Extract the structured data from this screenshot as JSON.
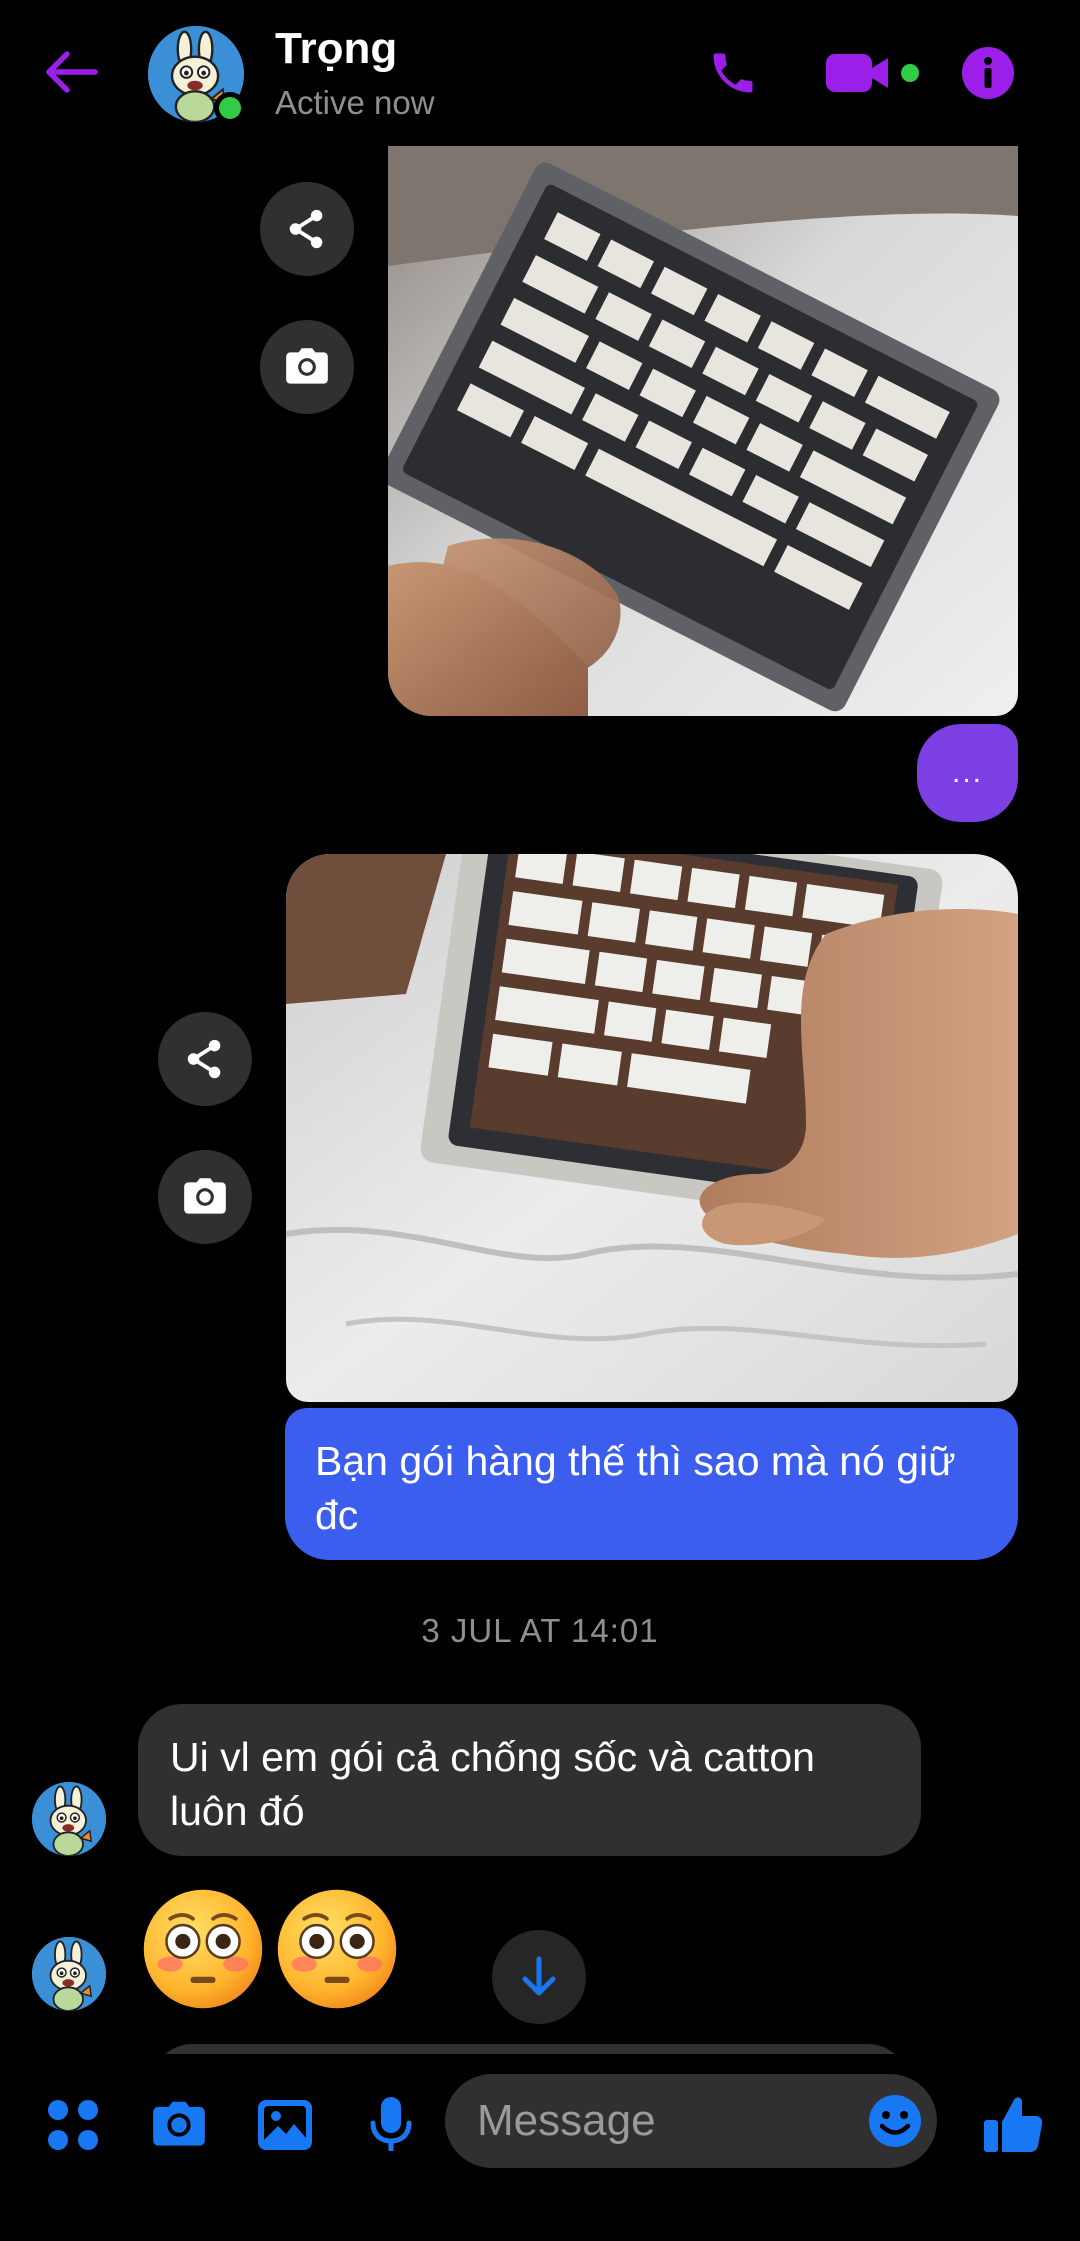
{
  "colors": {
    "accent": "#9b1fe8",
    "sent_bubble": "#3b5eee",
    "typing_bubble": "#7b3fe4",
    "received_bubble": "#303030",
    "online": "#31cc46",
    "composer_icon": "#1877f2"
  },
  "header": {
    "name": "Trọng",
    "status": "Active now",
    "icons": [
      "back-arrow-icon",
      "phone-icon",
      "video-camera-icon",
      "info-icon"
    ]
  },
  "thread": {
    "typing_indicator": "...",
    "outgoing_message": "Bạn gói hàng thế thì sao mà nó giữ đc",
    "timestamp": "3 JUL AT 14:01",
    "incoming_message": "Ui vl em gói cả chống sốc và catton luôn đó",
    "emoji_reaction": [
      "flushed-face",
      "flushed-face"
    ],
    "media_actions": [
      "share-icon",
      "camera-icon"
    ]
  },
  "composer": {
    "placeholder": "Message",
    "icons": [
      "apps-icon",
      "camera-icon",
      "gallery-icon",
      "microphone-icon",
      "emoji-icon",
      "thumbs-up-icon"
    ]
  }
}
